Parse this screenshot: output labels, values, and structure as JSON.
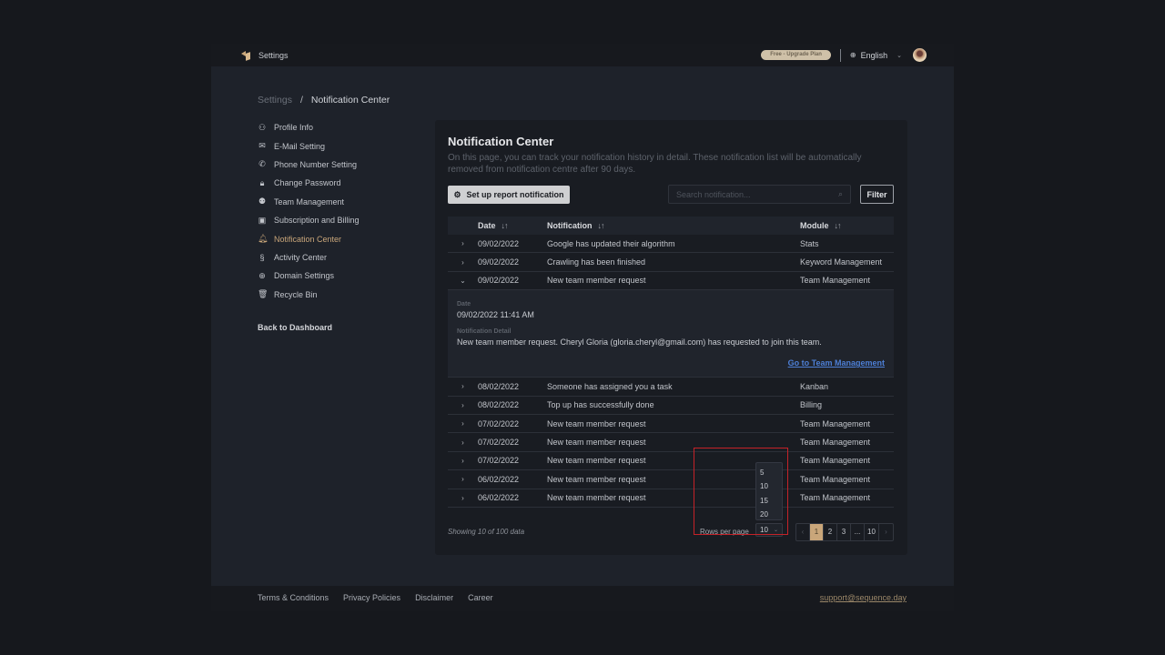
{
  "topbar": {
    "title": "Settings",
    "plan_badge": "Free - Upgrade Plan",
    "language": "English",
    "icons": {
      "logo": "brand-logo",
      "globe": "globe-icon",
      "chevron": "chevron-down-icon",
      "avatar": "user-avatar"
    }
  },
  "breadcrumb": {
    "root": "Settings",
    "separator": "/",
    "current": "Notification Center"
  },
  "sidebar": {
    "items": [
      {
        "label": "Profile Info",
        "icon": "user-icon",
        "glyph": "⚇",
        "active": false
      },
      {
        "label": "E-Mail Setting",
        "icon": "mail-icon",
        "glyph": "✉",
        "active": false
      },
      {
        "label": "Phone Number Setting",
        "icon": "phone-icon",
        "glyph": "✆",
        "active": false
      },
      {
        "label": "Change Password",
        "icon": "lock-icon",
        "glyph": "🔒︎",
        "active": false
      },
      {
        "label": "Team Management",
        "icon": "team-icon",
        "glyph": "⚉",
        "active": false
      },
      {
        "label": "Subscription and Billing",
        "icon": "billing-icon",
        "glyph": "▣",
        "active": false
      },
      {
        "label": "Notification Center",
        "icon": "bell-icon",
        "glyph": "🔔︎",
        "active": true
      },
      {
        "label": "Activity Center",
        "icon": "activity-icon",
        "glyph": "§",
        "active": false
      },
      {
        "label": "Domain Settings",
        "icon": "globe-icon",
        "glyph": "⊕",
        "active": false
      },
      {
        "label": "Recycle Bin",
        "icon": "trash-icon",
        "glyph": "🗑︎",
        "active": false
      }
    ],
    "back_link": "Back to Dashboard"
  },
  "main": {
    "title": "Notification Center",
    "description": "On this page, you can track your notification history in detail. These notification list will be automatically removed from notification centre after 90 days.",
    "setup_button": "Set up report notification",
    "search_placeholder": "Search notification...",
    "filter_button": "Filter",
    "table": {
      "headers": {
        "date": "Date",
        "notification": "Notification",
        "module": "Module"
      },
      "rows_before": [
        {
          "date": "09/02/2022",
          "notification": "Google has updated their algorithm",
          "module": "Stats"
        },
        {
          "date": "09/02/2022",
          "notification": "Crawling has been finished",
          "module": "Keyword Management"
        },
        {
          "date": "09/02/2022",
          "notification": "New team member request",
          "module": "Team Management",
          "expanded": true
        }
      ],
      "detail": {
        "date_label": "Date",
        "date_value": "09/02/2022 11:41 AM",
        "detail_label": "Notification Detail",
        "detail_value": "New team member request. Cheryl Gloria (gloria.cheryl@gmail.com) has requested to join this team.",
        "link": "Go to Team Management"
      },
      "rows_after": [
        {
          "date": "08/02/2022",
          "notification": "Someone has assigned you a task",
          "module": "Kanban"
        },
        {
          "date": "08/02/2022",
          "notification": "Top up has successfully done",
          "module": "Billing"
        },
        {
          "date": "07/02/2022",
          "notification": "New team member request",
          "module": "Team Management"
        },
        {
          "date": "07/02/2022",
          "notification": "New team member request",
          "module": "Team Management"
        },
        {
          "date": "07/02/2022",
          "notification": "New team member request",
          "module": "Team Management"
        },
        {
          "date": "06/02/2022",
          "notification": "New team member request",
          "module": "Team Management"
        },
        {
          "date": "06/02/2022",
          "notification": "New team member request",
          "module": "Team Management"
        }
      ]
    },
    "pagination": {
      "showing": "Showing 10 of 100 data",
      "rows_per_page_label": "Rows per page",
      "rows_per_page_value": "10",
      "rows_per_page_options": [
        "5",
        "10",
        "15",
        "20"
      ],
      "pages": [
        "‹",
        "1",
        "2",
        "3",
        "...",
        "10",
        "›"
      ],
      "current_page": "1"
    }
  },
  "footer": {
    "links": [
      "Terms & Conditions",
      "Privacy Policies",
      "Disclaimer",
      "Career"
    ],
    "support_email": "support@sequence.day"
  },
  "colors": {
    "accent": "#c9a67a",
    "link": "#4d7fd6",
    "highlight": "#c52228"
  }
}
